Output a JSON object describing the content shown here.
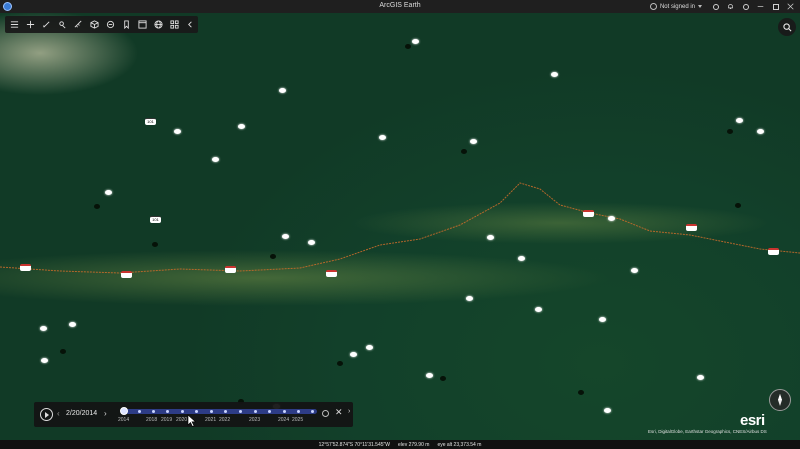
{
  "app": {
    "title": "ArcGIS Earth"
  },
  "titlebar": {
    "user_label": "Not signed in",
    "buttons": [
      "settings-icon",
      "bell-icon",
      "info-icon",
      "minimize-icon",
      "maximize-icon",
      "close-icon"
    ]
  },
  "toolbar": {
    "tools": [
      "list-icon",
      "add-icon",
      "draw-icon",
      "measure-icon",
      "ruler-icon",
      "cube-icon",
      "layers-icon",
      "bookmark-icon",
      "window-icon",
      "globe-icon",
      "grid-icon",
      "collapse-chevron-icon"
    ]
  },
  "map": {
    "highway_labels": [
      "101",
      "101"
    ],
    "accent_road": "#c56a2a",
    "accent_shield": "#c9342f"
  },
  "time_slider": {
    "date": "2/20/2014",
    "years": [
      "2014",
      "2018",
      "2019",
      "2020",
      "2021",
      "2022",
      "2023",
      "2024",
      "2025"
    ],
    "prev_label": "‹",
    "next_label": "›",
    "close_label": "✕",
    "track_color": "#2d3c86"
  },
  "logo": {
    "text": "esri"
  },
  "attribution": "Esri, DigitalGlobe, Earthstar Geographics, CNES/Airbus DS",
  "status": {
    "coordinates": "12°57'52.874\"S 70°11'31.545\"W",
    "elevation": "elev 279.90 m",
    "eye_alt": "eye alt 23,373.54 m"
  }
}
